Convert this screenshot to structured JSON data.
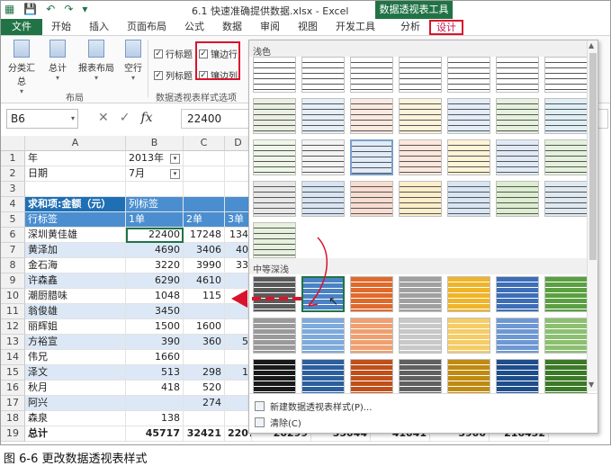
{
  "title_bar": {
    "window_title": "6.1 快速准确提供数据.xlsx - Excel",
    "context_group": "数据透视表工具"
  },
  "tabs": [
    "文件",
    "开始",
    "插入",
    "页面布局",
    "公式",
    "数据",
    "审阅",
    "视图",
    "开发工具",
    "分析",
    "设计"
  ],
  "ribbon": {
    "layout_buttons": [
      "分类汇总",
      "总计",
      "报表布局",
      "空行"
    ],
    "layout_group_label": "布局",
    "options": {
      "row_headers": "行标题",
      "col_headers": "列标题",
      "banded_rows": "镶边行",
      "banded_cols": "镶边列"
    },
    "options_group_label": "数据透视表样式选项"
  },
  "formula_bar": {
    "name_box": "B6",
    "fx": "fx",
    "value": "22400"
  },
  "columns": [
    "A",
    "B",
    "C",
    "D"
  ],
  "rows": [
    {
      "n": "1",
      "a": "年",
      "b": "2013年",
      "f": true
    },
    {
      "n": "2",
      "a": "日期",
      "b": "7月",
      "f": true
    },
    {
      "n": "3",
      "a": "",
      "b": ""
    },
    {
      "n": "4",
      "a": "求和项:金额（元）",
      "b": "列标签"
    },
    {
      "n": "5",
      "a": "行标签",
      "b": "1单",
      "c": "2单",
      "d": "3单"
    },
    {
      "n": "6",
      "a": "深圳黄佳雄",
      "b": "22400",
      "c": "17248",
      "d": "134"
    },
    {
      "n": "7",
      "a": "黄泽加",
      "b": "4690",
      "c": "3406",
      "d": "40"
    },
    {
      "n": "8",
      "a": "金石海",
      "b": "3220",
      "c": "3990",
      "d": "33"
    },
    {
      "n": "9",
      "a": "许森鑫",
      "b": "6290",
      "c": "4610",
      "d": ""
    },
    {
      "n": "10",
      "a": "潮厨腊味",
      "b": "1048",
      "c": "115",
      "d": ""
    },
    {
      "n": "11",
      "a": "翁俊雄",
      "b": "3450",
      "c": "",
      "d": ""
    },
    {
      "n": "12",
      "a": "丽辉姐",
      "b": "1500",
      "c": "1600",
      "d": ""
    },
    {
      "n": "13",
      "a": "方裕宣",
      "b": "390",
      "c": "360",
      "d": "5"
    },
    {
      "n": "14",
      "a": "伟兄",
      "b": "1660",
      "c": "",
      "d": ""
    },
    {
      "n": "15",
      "a": "泽文",
      "b": "513",
      "c": "298",
      "d": "1"
    },
    {
      "n": "16",
      "a": "秋月",
      "b": "418",
      "c": "520",
      "d": ""
    },
    {
      "n": "17",
      "a": "阿兴",
      "b": "",
      "c": "274",
      "d": ""
    },
    {
      "n": "18",
      "a": "森泉",
      "b": "138",
      "c": "",
      "d": ""
    },
    {
      "n": "19",
      "a": "总计",
      "b": "45717",
      "c": "32421",
      "d": "22070"
    }
  ],
  "row19_extra": [
    "20299",
    "35044",
    "41041",
    "5900",
    "216432"
  ],
  "gallery": {
    "light_label": "浅色",
    "medium_label": "中等深浅",
    "new_style": "新建数据透视表样式(P)...",
    "clear": "清除(C)"
  },
  "caption": "图 6-6  更改数据透视表样式"
}
